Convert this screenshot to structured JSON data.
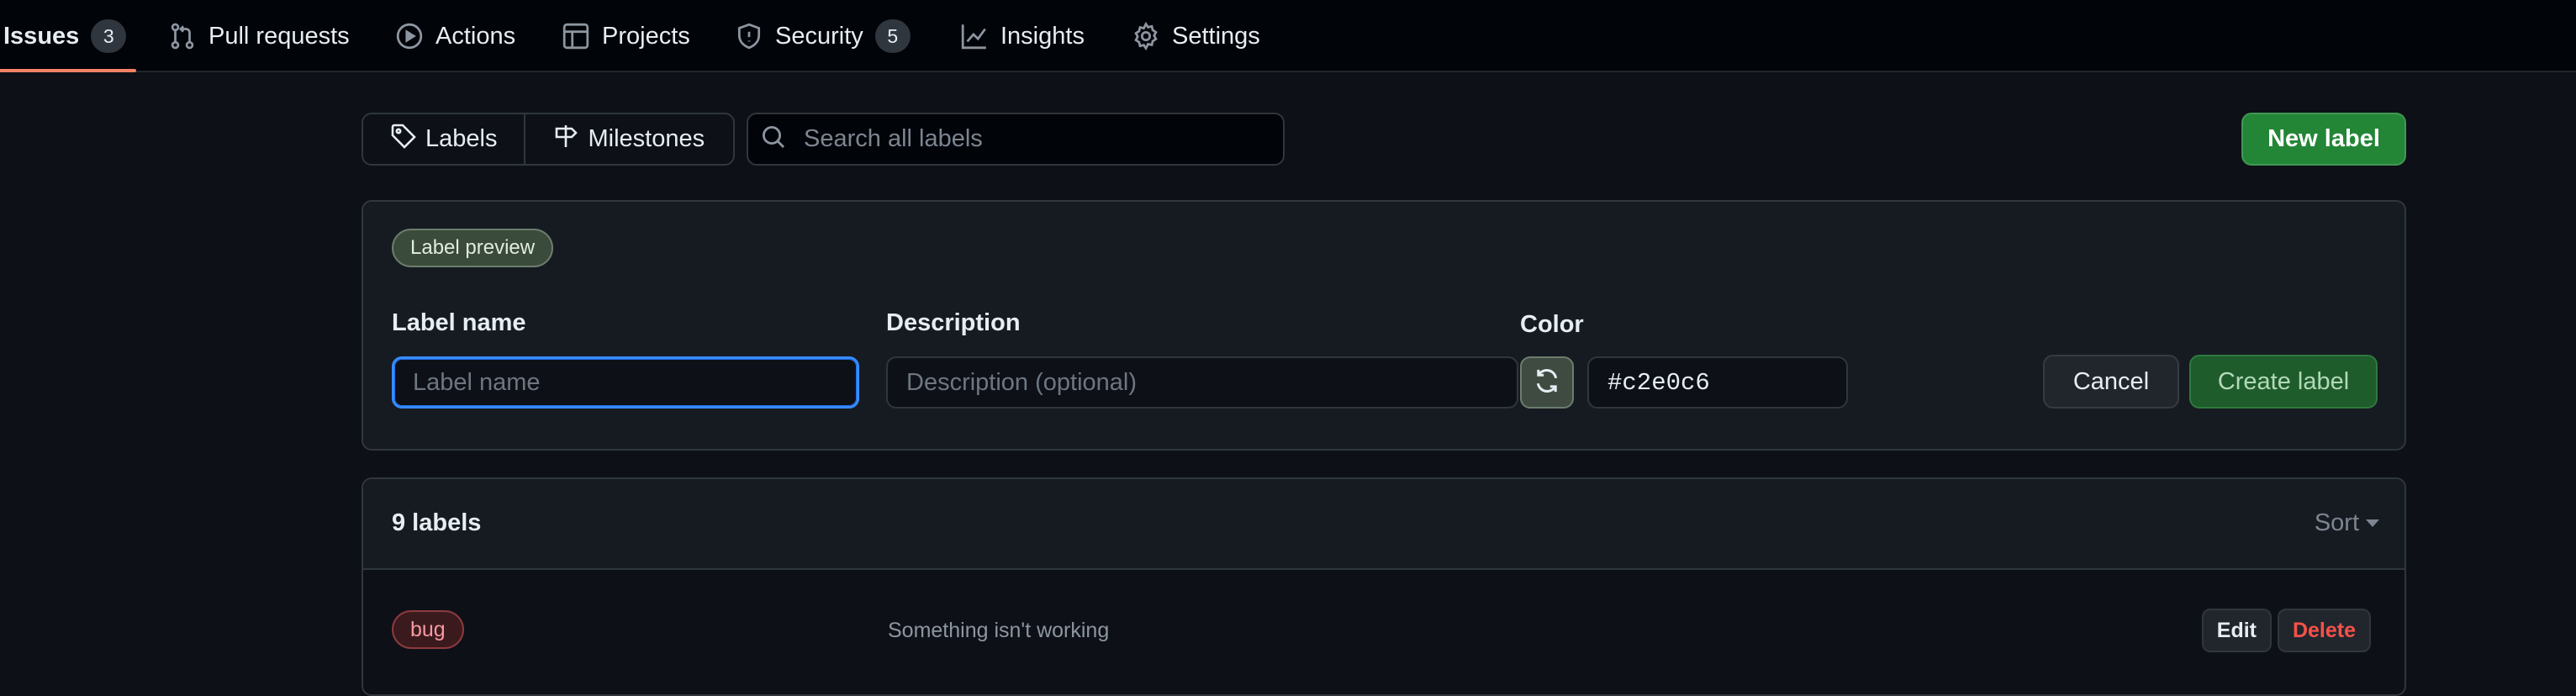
{
  "nav": {
    "items": [
      {
        "label": "Issues",
        "icon": "issue-icon",
        "counter": "3",
        "active": true
      },
      {
        "label": "Pull requests",
        "icon": "git-pull-request-icon"
      },
      {
        "label": "Actions",
        "icon": "play-icon"
      },
      {
        "label": "Projects",
        "icon": "table-icon"
      },
      {
        "label": "Security",
        "icon": "shield-icon",
        "counter": "5"
      },
      {
        "label": "Insights",
        "icon": "graph-icon"
      },
      {
        "label": "Settings",
        "icon": "gear-icon"
      }
    ]
  },
  "subnav": {
    "labels": "Labels",
    "milestones": "Milestones"
  },
  "search": {
    "placeholder": "Search all labels"
  },
  "new_label_button": "New label",
  "create_form": {
    "preview": "Label preview",
    "name_label": "Label name",
    "name_placeholder": "Label name",
    "name_value": "",
    "description_label": "Description",
    "description_placeholder": "Description (optional)",
    "description_value": "",
    "color_label": "Color",
    "color_value": "#c2e0c6",
    "cancel": "Cancel",
    "create": "Create label"
  },
  "labels": {
    "count_text": "9 labels",
    "sort": "Sort",
    "rows": [
      {
        "name": "bug",
        "description": "Something isn't working",
        "color": "#d73a4a",
        "edit": "Edit",
        "delete": "Delete"
      }
    ]
  },
  "colors": {
    "primary": "#238636",
    "danger": "#f85149",
    "focus": "#388bfd",
    "active_tab_underline": "#f78166"
  }
}
